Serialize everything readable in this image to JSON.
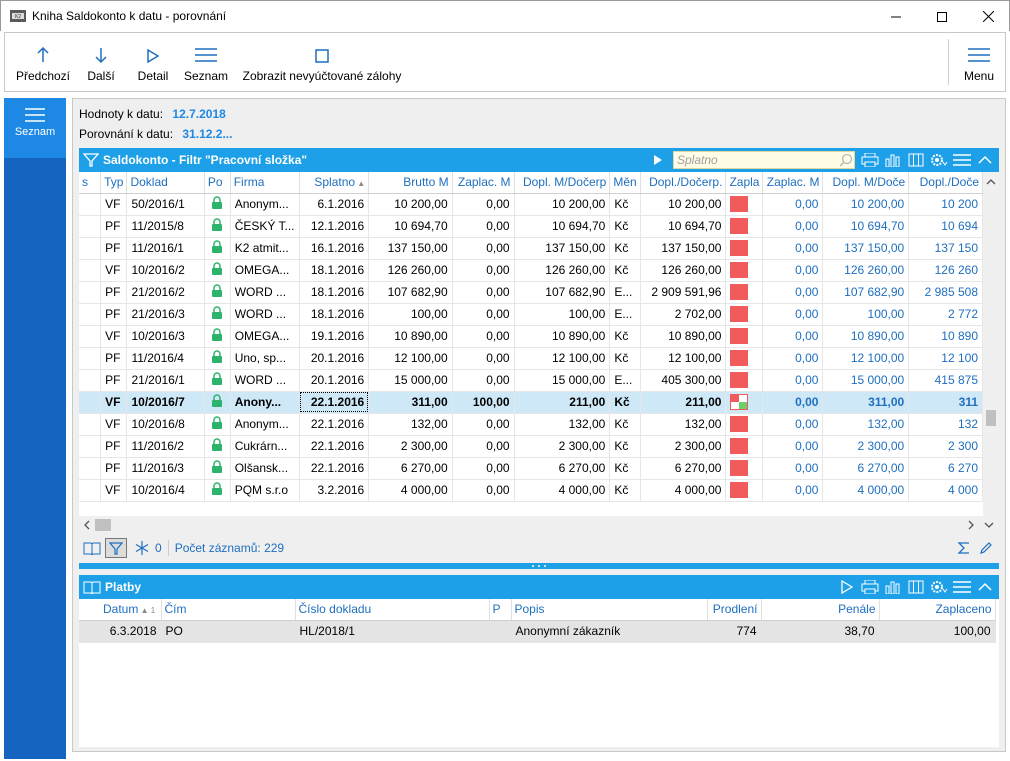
{
  "window": {
    "title": "Kniha Saldokonto k datu - porovnání"
  },
  "toolbar": {
    "prev": "Předchozí",
    "next": "Další",
    "detail": "Detail",
    "list": "Seznam",
    "show_unsettled": "Zobrazit nevyúčtované zálohy",
    "menu": "Menu"
  },
  "left": {
    "tab_label": "Seznam"
  },
  "header": {
    "values_label": "Hodnoty k datu:",
    "values_date": "12.7.2018",
    "compare_label": "Porovnání k datu:",
    "compare_date": "31.12.2..."
  },
  "saldo": {
    "title": "Saldokonto - Filtr \"Pracovní složka\"",
    "search_placeholder": "Splatno",
    "columns": [
      "s",
      "Typ",
      "Doklad",
      "Po",
      "Firma",
      "Splatno",
      "Brutto M",
      "Zaplac. M",
      "Dopl. M/Dočerp",
      "Měn",
      "Dopl./Dočerp.",
      "Zapla",
      "Zaplac. M",
      "Dopl. M/Doče",
      "Dopl./Doče"
    ],
    "rows": [
      {
        "typ": "VF",
        "doklad": "50/2016/1",
        "firma": "Anonym...",
        "splatno": "6.1.2016",
        "brutto": "10 200,00",
        "zaplac": "0,00",
        "dopl": "10 200,00",
        "men": "Kč",
        "dopl2": "10 200,00",
        "zaplac2": "0,00",
        "dopl3": "10 200,00",
        "dopl4": "10 200"
      },
      {
        "typ": "PF",
        "doklad": "11/2015/8",
        "firma": "ČESKÝ T...",
        "splatno": "12.1.2016",
        "brutto": "10 694,70",
        "zaplac": "0,00",
        "dopl": "10 694,70",
        "men": "Kč",
        "dopl2": "10 694,70",
        "zaplac2": "0,00",
        "dopl3": "10 694,70",
        "dopl4": "10 694"
      },
      {
        "typ": "PF",
        "doklad": "11/2016/1",
        "firma": "K2 atmit...",
        "splatno": "16.1.2016",
        "brutto": "137 150,00",
        "zaplac": "0,00",
        "dopl": "137 150,00",
        "men": "Kč",
        "dopl2": "137 150,00",
        "zaplac2": "0,00",
        "dopl3": "137 150,00",
        "dopl4": "137 150"
      },
      {
        "typ": "VF",
        "doklad": "10/2016/2",
        "firma": "OMEGA...",
        "splatno": "18.1.2016",
        "brutto": "126 260,00",
        "zaplac": "0,00",
        "dopl": "126 260,00",
        "men": "Kč",
        "dopl2": "126 260,00",
        "zaplac2": "0,00",
        "dopl3": "126 260,00",
        "dopl4": "126 260"
      },
      {
        "typ": "PF",
        "doklad": "21/2016/2",
        "firma": "WORD ...",
        "splatno": "18.1.2016",
        "brutto": "107 682,90",
        "zaplac": "0,00",
        "dopl": "107 682,90",
        "men": "E...",
        "dopl2": "2 909 591,96",
        "zaplac2": "0,00",
        "dopl3": "107 682,90",
        "dopl4": "2 985 508"
      },
      {
        "typ": "PF",
        "doklad": "21/2016/3",
        "firma": "WORD ...",
        "splatno": "18.1.2016",
        "brutto": "100,00",
        "zaplac": "0,00",
        "dopl": "100,00",
        "men": "E...",
        "dopl2": "2 702,00",
        "zaplac2": "0,00",
        "dopl3": "100,00",
        "dopl4": "2 772"
      },
      {
        "typ": "VF",
        "doklad": "10/2016/3",
        "firma": "OMEGA...",
        "splatno": "19.1.2016",
        "brutto": "10 890,00",
        "zaplac": "0,00",
        "dopl": "10 890,00",
        "men": "Kč",
        "dopl2": "10 890,00",
        "zaplac2": "0,00",
        "dopl3": "10 890,00",
        "dopl4": "10 890"
      },
      {
        "typ": "PF",
        "doklad": "11/2016/4",
        "firma": "Uno, sp...",
        "splatno": "20.1.2016",
        "brutto": "12 100,00",
        "zaplac": "0,00",
        "dopl": "12 100,00",
        "men": "Kč",
        "dopl2": "12 100,00",
        "zaplac2": "0,00",
        "dopl3": "12 100,00",
        "dopl4": "12 100"
      },
      {
        "typ": "PF",
        "doklad": "21/2016/1",
        "firma": "WORD ...",
        "splatno": "20.1.2016",
        "brutto": "15 000,00",
        "zaplac": "0,00",
        "dopl": "15 000,00",
        "men": "E...",
        "dopl2": "405 300,00",
        "zaplac2": "0,00",
        "dopl3": "15 000,00",
        "dopl4": "415 875"
      },
      {
        "typ": "VF",
        "doklad": "10/2016/7",
        "firma": "Anony...",
        "splatno": "22.1.2016",
        "brutto": "311,00",
        "zaplac": "100,00",
        "dopl": "211,00",
        "men": "Kč",
        "dopl2": "211,00",
        "zaplac2": "0,00",
        "dopl3": "311,00",
        "dopl4": "311",
        "selected": true
      },
      {
        "typ": "VF",
        "doklad": "10/2016/8",
        "firma": "Anonym...",
        "splatno": "22.1.2016",
        "brutto": "132,00",
        "zaplac": "0,00",
        "dopl": "132,00",
        "men": "Kč",
        "dopl2": "132,00",
        "zaplac2": "0,00",
        "dopl3": "132,00",
        "dopl4": "132"
      },
      {
        "typ": "PF",
        "doklad": "11/2016/2",
        "firma": "Cukrárn...",
        "splatno": "22.1.2016",
        "brutto": "2 300,00",
        "zaplac": "0,00",
        "dopl": "2 300,00",
        "men": "Kč",
        "dopl2": "2 300,00",
        "zaplac2": "0,00",
        "dopl3": "2 300,00",
        "dopl4": "2 300"
      },
      {
        "typ": "PF",
        "doklad": "11/2016/3",
        "firma": "Olšansk...",
        "splatno": "22.1.2016",
        "brutto": "6 270,00",
        "zaplac": "0,00",
        "dopl": "6 270,00",
        "men": "Kč",
        "dopl2": "6 270,00",
        "zaplac2": "0,00",
        "dopl3": "6 270,00",
        "dopl4": "6 270"
      },
      {
        "typ": "VF",
        "doklad": "10/2016/4",
        "firma": "PQM s.r.o",
        "splatno": "3.2.2016",
        "brutto": "4 000,00",
        "zaplac": "0,00",
        "dopl": "4 000,00",
        "men": "Kč",
        "dopl2": "4 000,00",
        "zaplac2": "0,00",
        "dopl3": "4 000,00",
        "dopl4": "4 000"
      }
    ],
    "filter_count": "0",
    "record_count": "Počet záznamů: 229"
  },
  "platby": {
    "title": "Platby",
    "columns": [
      "Datum",
      "Čím",
      "Číslo dokladu",
      "P",
      "Popis",
      "Prodlení",
      "Penále",
      "Zaplaceno"
    ],
    "sort_indicator": "1",
    "rows": [
      {
        "datum": "6.3.2018",
        "cim": "PO",
        "cislo": "HL/2018/1",
        "p": "",
        "popis": "Anonymní zákazník",
        "prodleni": "774",
        "penale": "38,70",
        "zaplaceno": "100,00"
      }
    ]
  },
  "colors": {
    "accent": "#1ea0e8",
    "left_panel": "#1565c0",
    "left_tab": "#1e88e5",
    "status_red": "#f25b5b",
    "status_green": "#6ccf6c",
    "selected_row": "#cfe8f7",
    "link_blue": "#1e6fbf"
  }
}
